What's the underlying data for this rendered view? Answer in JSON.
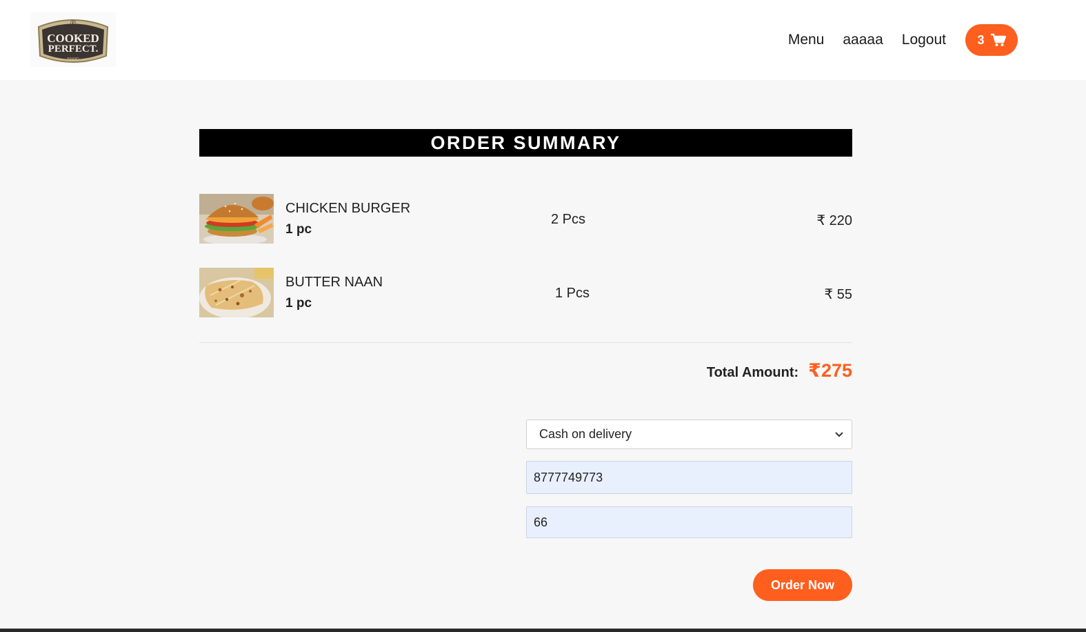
{
  "brand": {
    "logo_line1": "COOKED",
    "logo_line2": "PERFECT",
    "logo_sub": "BRAND"
  },
  "nav": {
    "items": [
      {
        "label": "Menu"
      },
      {
        "label": "aaaaa"
      },
      {
        "label": "Logout"
      }
    ],
    "cart_count": "3",
    "cart_icon": "shopping-cart-icon"
  },
  "summary": {
    "title": "ORDER SUMMARY",
    "items": [
      {
        "name": "CHICKEN BURGER",
        "unit": "1 pc",
        "qty": "2 Pcs",
        "price": "₹ 220",
        "image": "burger-image"
      },
      {
        "name": "BUTTER NAAN",
        "unit": "1 pc",
        "qty": "1 Pcs",
        "price": "₹ 55",
        "image": "naan-image"
      }
    ],
    "total_label": "Total Amount:",
    "total_value": "₹275"
  },
  "form": {
    "payment_method": "Cash on delivery",
    "phone_value": "8777749773",
    "address_value": "66",
    "submit_label": "Order Now"
  },
  "colors": {
    "accent": "#fe5f1e",
    "header_bar": "#000000",
    "autofill_bg": "#e8f0fe"
  }
}
